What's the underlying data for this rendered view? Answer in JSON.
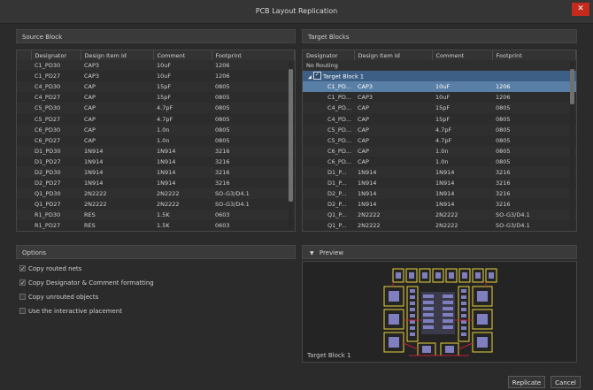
{
  "window": {
    "title": "PCB Layout Replication",
    "close_glyph": "✕"
  },
  "source": {
    "header": "Source Block",
    "columns": [
      "Designator",
      "Design Item Id",
      "Comment",
      "Footprint"
    ],
    "rows": [
      [
        "C1_PD30",
        "CAP3",
        "10uF",
        "1206"
      ],
      [
        "C1_PD27",
        "CAP3",
        "10uF",
        "1206"
      ],
      [
        "C4_PD30",
        "CAP",
        "15pF",
        "0805"
      ],
      [
        "C4_PD27",
        "CAP",
        "15pF",
        "0805"
      ],
      [
        "C5_PD30",
        "CAP",
        "4.7pF",
        "0805"
      ],
      [
        "C5_PD27",
        "CAP",
        "4.7pF",
        "0805"
      ],
      [
        "C6_PD30",
        "CAP",
        "1.0n",
        "0805"
      ],
      [
        "C6_PD27",
        "CAP",
        "1.0n",
        "0805"
      ],
      [
        "D1_PD30",
        "1N914",
        "1N914",
        "3216"
      ],
      [
        "D1_PD27",
        "1N914",
        "1N914",
        "3216"
      ],
      [
        "D2_PD30",
        "1N914",
        "1N914",
        "3216"
      ],
      [
        "D2_PD27",
        "1N914",
        "1N914",
        "3216"
      ],
      [
        "Q1_PD30",
        "2N2222",
        "2N2222",
        "SO-G3/D4.1"
      ],
      [
        "Q1_PD27",
        "2N2222",
        "2N2222",
        "SO-G3/D4.1"
      ],
      [
        "R1_PD30",
        "RES",
        "1.5K",
        "0603"
      ],
      [
        "R1_PD27",
        "RES",
        "1.5K",
        "0603"
      ]
    ]
  },
  "target": {
    "header": "Target Blocks",
    "columns": [
      "Designator",
      "Design Item Id",
      "Comment",
      "Footprint"
    ],
    "no_routing": "No Routing",
    "group_label": "Target Block 1",
    "rows": [
      [
        "C1_PD...",
        "CAP3",
        "10uF",
        "1206"
      ],
      [
        "C1_PD...",
        "CAP3",
        "10uF",
        "1206"
      ],
      [
        "C4_PD...",
        "CAP",
        "15pF",
        "0805"
      ],
      [
        "C4_PD...",
        "CAP",
        "15pF",
        "0805"
      ],
      [
        "C5_PD...",
        "CAP",
        "4.7pF",
        "0805"
      ],
      [
        "C5_PD...",
        "CAP",
        "4.7pF",
        "0805"
      ],
      [
        "C6_PD...",
        "CAP",
        "1.0n",
        "0805"
      ],
      [
        "C6_PD...",
        "CAP",
        "1.0n",
        "0805"
      ],
      [
        "D1_P...",
        "1N914",
        "1N914",
        "3216"
      ],
      [
        "D1_P...",
        "1N914",
        "1N914",
        "3216"
      ],
      [
        "D2_P...",
        "1N914",
        "1N914",
        "3216"
      ],
      [
        "D2_P...",
        "1N914",
        "1N914",
        "3216"
      ],
      [
        "Q1_P...",
        "2N2222",
        "2N2222",
        "SO-G3/D4.1"
      ],
      [
        "Q1_P...",
        "2N2222",
        "2N2222",
        "SO-G3/D4.1"
      ]
    ]
  },
  "options": {
    "header": "Options",
    "items": [
      {
        "label": "Copy routed nets",
        "checked": true
      },
      {
        "label": "Copy Designator & Comment formatting",
        "checked": true
      },
      {
        "label": "Copy unrouted objects",
        "checked": false
      },
      {
        "label": "Use the interactive placement",
        "checked": false
      }
    ]
  },
  "preview": {
    "header": "Preview",
    "caption": "Target Block 1"
  },
  "buttons": {
    "replicate": "Replicate",
    "cancel": "Cancel"
  },
  "colors": {
    "selection": "#5a7fa6",
    "close": "#c42b1c",
    "pcb_yellow": "#e8d23a",
    "pcb_pad": "#7f7fbf",
    "pcb_red": "#c0203a"
  }
}
